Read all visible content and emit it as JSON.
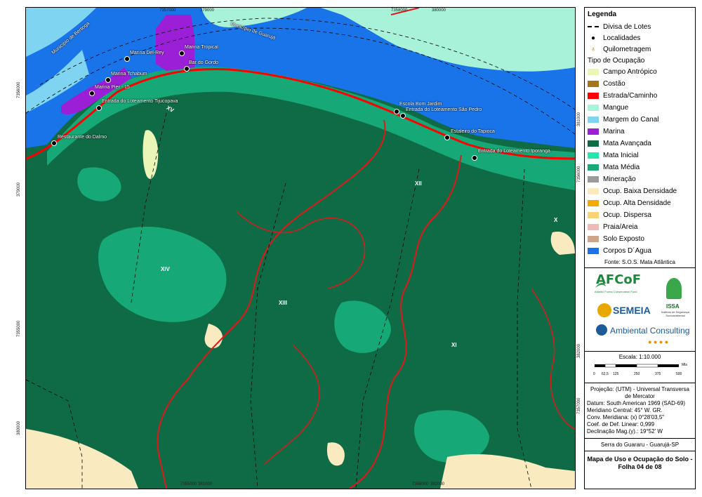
{
  "map": {
    "coords_top": [
      "7357000",
      "379000",
      "7358000",
      "380000"
    ],
    "coords_bottom": [
      "7355000",
      "381000",
      "7356000",
      "382000"
    ],
    "coords_left": [
      "7356000",
      "379000",
      "7355000",
      "380000"
    ],
    "coords_right": [
      "381000",
      "7356000",
      "382000",
      "7357000"
    ],
    "regions": [
      "Município de Bertioga",
      "Município de Guarujá"
    ],
    "zones": [
      "XIV",
      "XIII",
      "XII",
      "XI",
      "X",
      "XV"
    ],
    "places": [
      "Marina Del-Rey",
      "Marina Tropical",
      "Bar do Gordo",
      "Marina Tchabum",
      "Marina Pier - 15",
      "Entrada do Loteamento Tijucopava",
      "Restaurante do Dalmo",
      "Escola Bom Jardim",
      "Entrada do Loteamento São Pedro",
      "Estaleiro do Tapioca",
      "Entrada do Loteamento Iporanga"
    ]
  },
  "legend": {
    "title": "Legenda",
    "lot_divide": "Divisa de Lotes",
    "localities": "Localidades",
    "km_marker": "Quilometragem",
    "occupation_header": "Tipo de Ocupação",
    "classes": [
      {
        "label": "Campo Antrópico",
        "color": "#eaf5b8"
      },
      {
        "label": "Costão",
        "color": "#a8741b"
      },
      {
        "label": "Estrada/Caminho",
        "color": "#ff0000"
      },
      {
        "label": "Mangue",
        "color": "#a9f2da"
      },
      {
        "label": "Margem do Canal",
        "color": "#7fd4f2"
      },
      {
        "label": "Marina",
        "color": "#9b1fd6"
      },
      {
        "label": "Mata Avançada",
        "color": "#0e6b45"
      },
      {
        "label": "Mata Inicial",
        "color": "#22e8b0"
      },
      {
        "label": "Mata Média",
        "color": "#16a877"
      },
      {
        "label": "Mineração",
        "color": "#9a9a9a"
      },
      {
        "label": "Ocup. Baixa Densidade",
        "color": "#faeac0"
      },
      {
        "label": "Ocup. Alta Densidade",
        "color": "#f5a800"
      },
      {
        "label": "Ocup. Dispersa",
        "color": "#f8d37a"
      },
      {
        "label": "Praia/Areia",
        "color": "#f2b8b8"
      },
      {
        "label": "Solo Exposto",
        "color": "#cfa58a"
      },
      {
        "label": "Corpos D´Agua",
        "color": "#1874e8"
      }
    ],
    "source": "Fonte: S.O.S. Mata Atlântica"
  },
  "logos": {
    "afcof": "AFCoF",
    "afcof_sub": "Atlantic Forest Conservation Fund",
    "semeia": "SEMEIA",
    "issa": "ISSA",
    "issa_sub": "Instituto de Segurança Socioambiental",
    "ambiental": "Ambiental Consulting"
  },
  "scale": {
    "title": "Escala: 1:10.000",
    "ticks": [
      "0",
      "62,5",
      "125",
      "250",
      "375",
      "500"
    ],
    "unit": "Mts"
  },
  "projection": {
    "line1": "Projeção: (UTM) - Universal Transversa de Mercator",
    "line2": "Datum: South American 1969 (SAD-69)",
    "line3": "Meridiano Central: 45° W. GR.",
    "line4": "Conv. Meridiana: (x) 0°28'03,5\"",
    "line5": "Coef. de Def. Linear: 0,999",
    "line6": "Declinação Mag.(y).: 19°52' W"
  },
  "place_name": "Serra do Guararu - Guarujá-SP",
  "map_title": "Mapa de Uso e Ocupação do Solo - Folha 04 de 08"
}
